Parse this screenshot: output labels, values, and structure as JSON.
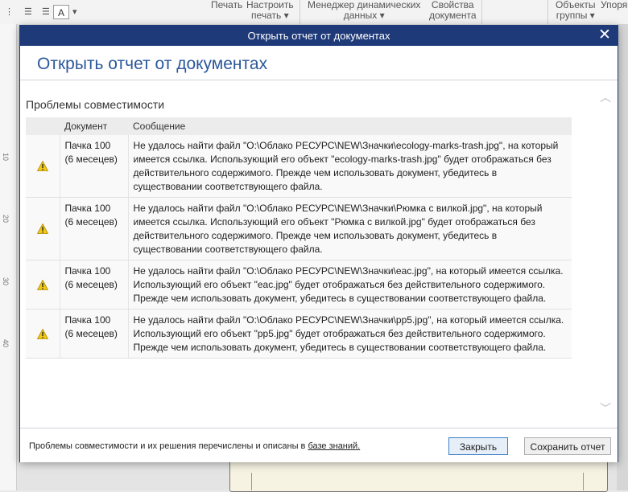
{
  "app": {
    "ribbon": {
      "font_box": "A",
      "buttons": [
        {
          "label": "Печать"
        },
        {
          "label_line1": "Настроить",
          "label_line2": "печать ▾"
        },
        {
          "label_line1": "Менеджер динамических",
          "label_line2": "данных ▾"
        },
        {
          "label_line1": "Свойства",
          "label_line2": "документа"
        },
        {
          "label_line1": "Объекты",
          "label_line2": "группы ▾"
        },
        {
          "label": "Упоря"
        }
      ]
    },
    "ruler": {
      "ticks": [
        "10",
        "20",
        "30",
        "40"
      ]
    }
  },
  "dialog": {
    "window_title": "Открыть отчет от документах",
    "header_title": "Открыть отчет от документах",
    "section_title": "Проблемы совместимости",
    "columns": {
      "document": "Документ",
      "message": "Сообщение"
    },
    "rows": [
      {
        "icon": "warning-icon",
        "doc_line1": "Пачка 100",
        "doc_line2": "(6 месецев)",
        "message": "Не удалось найти файл \"O:\\Облако РЕСУРС\\NEW\\Значки\\ecology-marks-trash.jpg\", на который имеется ссылка. Использующий его объект \"ecology-marks-trash.jpg\" будет отображаться без действительного содержимого. Прежде чем использовать документ, убедитесь в существовании соответствующего файла."
      },
      {
        "icon": "warning-icon",
        "doc_line1": "Пачка 100",
        "doc_line2": "(6 месецев)",
        "message": "Не удалось найти файл \"O:\\Облако РЕСУРС\\NEW\\Значки\\Рюмка с вилкой.jpg\", на который имеется ссылка. Использующий его объект \"Рюмка с вилкой.jpg\" будет отображаться без действительного содержимого. Прежде чем использовать документ, убедитесь в существовании соответствующего файла."
      },
      {
        "icon": "warning-icon",
        "doc_line1": "Пачка 100",
        "doc_line2": "(6 месецев)",
        "message": "Не удалось найти файл \"O:\\Облако РЕСУРС\\NEW\\Значки\\eac.jpg\", на который имеется ссылка. Использующий его объект \"eac.jpg\" будет отображаться без действительного содержимого. Прежде чем использовать документ, убедитесь в существовании соответствующего файла."
      },
      {
        "icon": "warning-icon",
        "doc_line1": "Пачка 100",
        "doc_line2": "(6 месецев)",
        "message": "Не удалось найти файл \"O:\\Облако РЕСУРС\\NEW\\Значки\\pp5.jpg\", на который имеется ссылка. Использующий его объект \"pp5.jpg\" будет отображаться без действительного содержимого. Прежде чем использовать документ, убедитесь в существовании соответствующего файла."
      }
    ],
    "footer": {
      "text": "Проблемы совместимости и их решения перечислены и описаны в ",
      "link": "базе знаний.",
      "close_button": "Закрыть",
      "save_button": "Сохранить отчет"
    },
    "colors": {
      "titlebar": "#1f3a79",
      "header_title": "#2b579a",
      "warning": "#f2c811"
    }
  }
}
